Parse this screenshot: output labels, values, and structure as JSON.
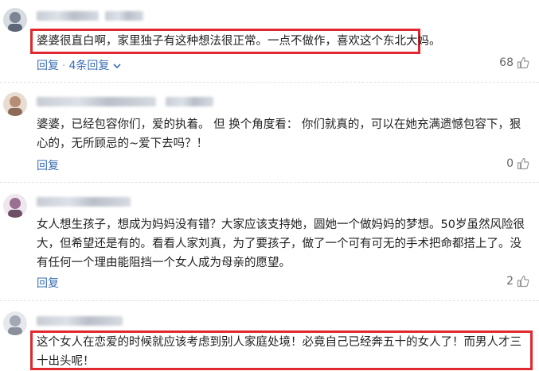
{
  "comments": [
    {
      "text": "婆婆很直白啊，家里独子有这种想法很正常。一点不做作，喜欢这个东北大妈。",
      "reply_label": "回复",
      "replies_label": "4条回复",
      "likes": "68"
    },
    {
      "text": "婆婆，已经包容你们，爱的执着。 但 换个角度看： 你们就真的，可以在她充满遗憾包容下，狠心的，无所顾忌的~爱下去吗？！",
      "reply_label": "回复",
      "likes": "0"
    },
    {
      "text": "女人想生孩子，想成为妈妈没有错？大家应该支持她，圆她一个做妈妈的梦想。50岁虽然风险很大，但希望还是有的。看看人家刘真，为了要孩子，做了一个可有可无的手术把命都搭上了。没有任何一个理由能阻挡一个女人成为母亲的愿望。",
      "reply_label": "回复",
      "likes": "2"
    },
    {
      "text": "这个女人在恋爱的时候就应该考虑到别人家庭处境！必竟自己已经奔五十的女人了！而男人才三十出头呢！"
    }
  ],
  "colors": {
    "highlight": "#e0282e",
    "link": "#3a6db5"
  },
  "icons": [
    "avatar",
    "chevron-down-icon",
    "thumbs-up-icon"
  ]
}
